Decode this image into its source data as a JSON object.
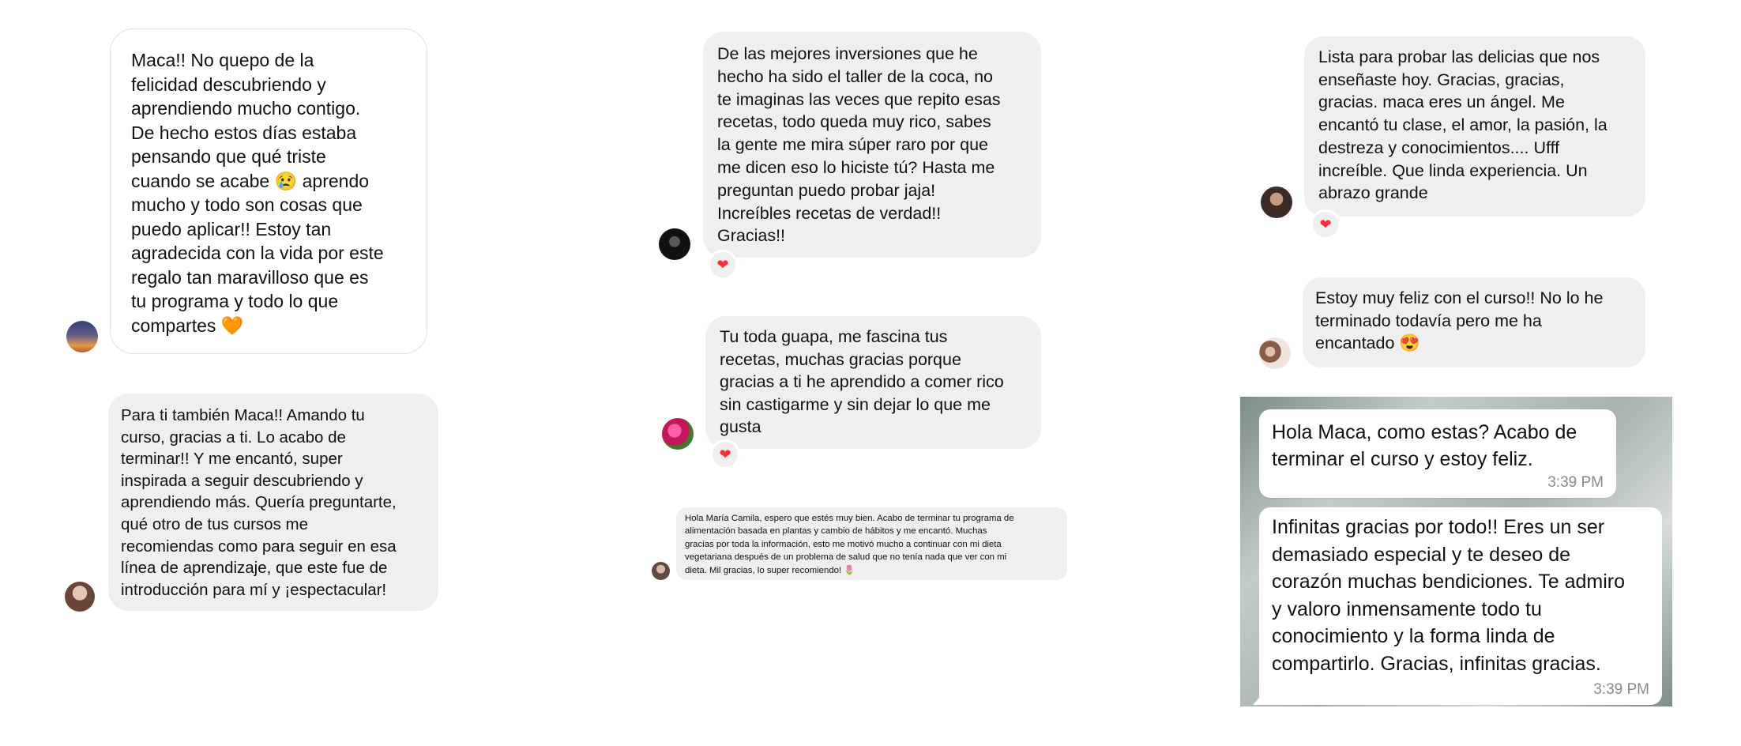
{
  "column1": {
    "msg1": {
      "text": "Maca!! No quepo de la\nfelicidad descubriendo y\naprendiendo mucho contigo.\nDe hecho estos días estaba\npensando que qué triste\ncuando se acabe 😢 aprendo\nmucho y todo son cosas que\npuedo aplicar!! Estoy tan\nagradecida con la vida por este\nregalo tan maravilloso que es\ntu programa y todo lo que\ncompartes 🧡"
    },
    "msg2": {
      "text": "Para ti también Maca!! Amando tu\ncurso, gracias a ti. Lo acabo de\nterminar!! Y me encantó, super\ninspirada a seguir descubriendo y\naprendiendo más. Quería preguntarte,\nqué otro de tus cursos me\nrecomiendas como para seguir en esa\nlínea de aprendizaje, que este fue de\nintroducción para mí y ¡espectacular!"
    }
  },
  "column2": {
    "msg1": {
      "text": "De las mejores inversiones que he\nhecho ha sido el taller de la coca, no\nte imaginas las veces que repito esas\nrecetas, todo queda muy rico, sabes\nla gente me mira súper raro por que\nme dicen eso lo hiciste tú? Hasta me\npreguntan puedo probar jaja!\nIncreíbles recetas de verdad!!\nGracias!!",
      "reaction": "❤"
    },
    "msg2": {
      "text": "Tu toda guapa, me fascina tus\nrecetas, muchas gracias porque\ngracias a ti he aprendido a comer rico\nsin castigarme y sin dejar lo que me\ngusta",
      "reaction": "❤"
    },
    "msg3": {
      "text": "Hola María Camila, espero que estés muy bien. Acabo de terminar tu programa de\nalimentación basada en plantas y cambio de hábitos y me encantó. Muchas\ngracias por toda la información, esto me motivó mucho a continuar con mi dieta\nvegetariana después de un problema de salud que no tenía nada que ver con mi\ndieta. Mil gracias, lo super recomiendo! 🌷"
    }
  },
  "column3": {
    "msg1": {
      "text": "Lista para probar las delicias que nos\nenseñaste hoy. Gracias, gracias,\ngracias. maca eres un ángel. Me\nencantó tu clase, el amor, la pasión, la\ndestreza y conocimientos.... Ufff\nincreíble. Que linda experiencia. Un\nabrazo grande",
      "reaction": "❤"
    },
    "msg2": {
      "text": "Estoy muy feliz con el curso!! No lo he\nterminado todavía pero me ha\nencantado 😍"
    }
  },
  "whatsapp": {
    "msg1": {
      "text": "Hola Maca, como estas? Acabo de\nterminar el curso y estoy feliz.",
      "time": "3:39 PM"
    },
    "msg2": {
      "text": "Infinitas gracias por todo!! Eres un ser\ndemasiado especial y te deseo de\ncorazón muchas bendiciones. Te admiro\ny valoro inmensamente todo tu\nconocimiento y la forma linda de\ncompartirlo. Gracias, infinitas gracias.",
      "time": "3:39 PM"
    }
  },
  "colors": {
    "bubble_gray": "#efefef",
    "bubble_white": "#ffffff",
    "heart": "#ff2d3c",
    "time_gray": "#8a8a8a"
  }
}
